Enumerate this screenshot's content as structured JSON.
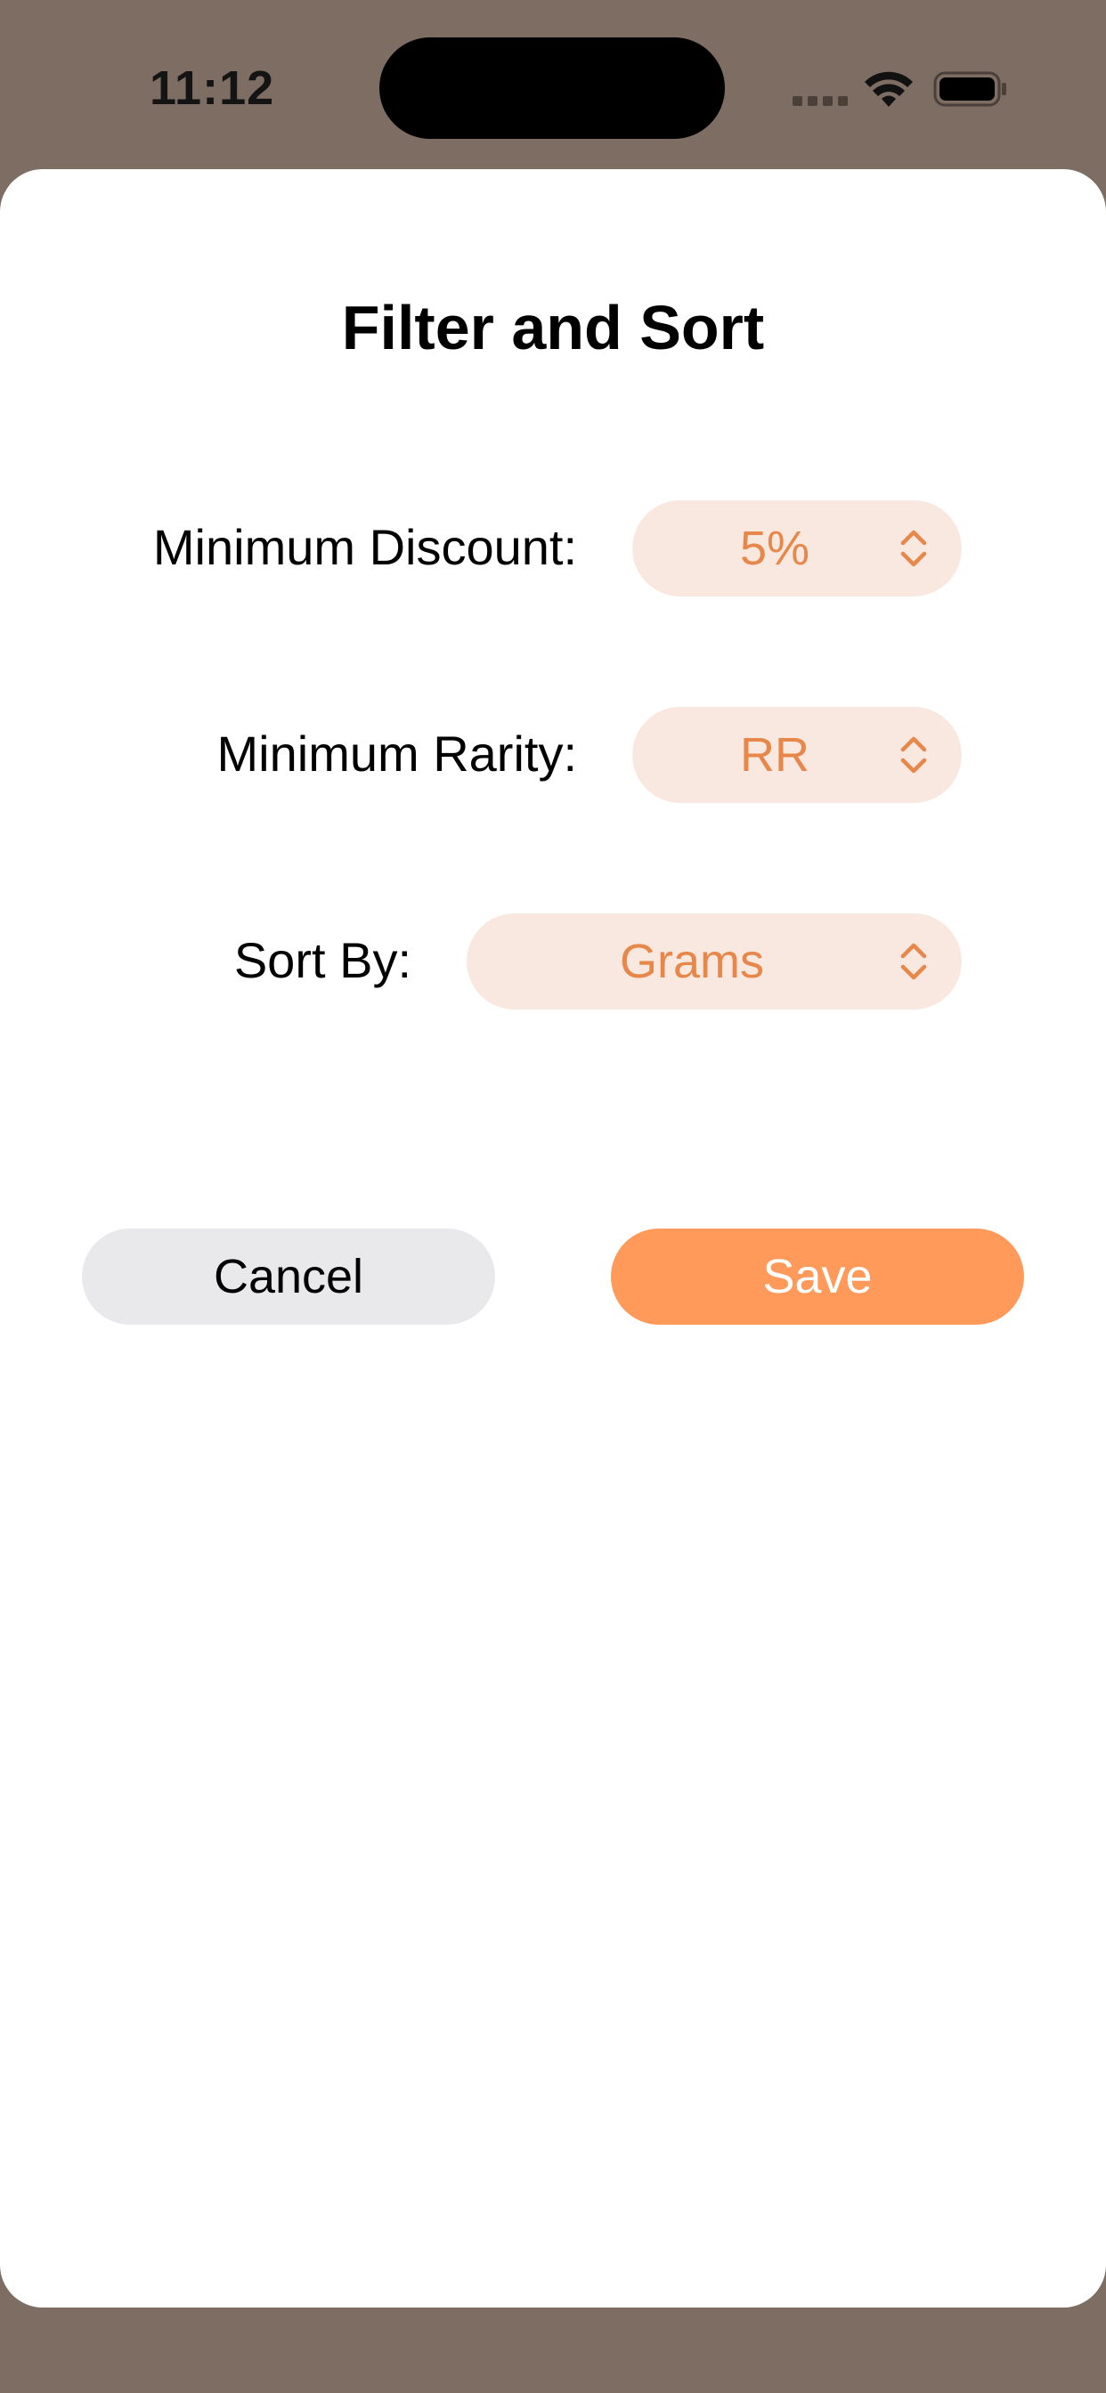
{
  "status_bar": {
    "time": "11:12",
    "icons": [
      "signal-icon",
      "wifi-icon",
      "battery-icon"
    ]
  },
  "sheet": {
    "title": "Filter and Sort",
    "rows": [
      {
        "label": "Minimum Discount:",
        "value": "5%"
      },
      {
        "label": "Minimum Rarity:",
        "value": "RR"
      },
      {
        "label": "Sort By:",
        "value": "Grams"
      }
    ],
    "cancel_label": "Cancel",
    "save_label": "Save"
  },
  "colors": {
    "backdrop": "#7d6d63",
    "accent": "#ff9a5a",
    "picker_background": "#f9e8df",
    "picker_text": "#e7874a",
    "cancel_background": "#e9e9eb"
  }
}
